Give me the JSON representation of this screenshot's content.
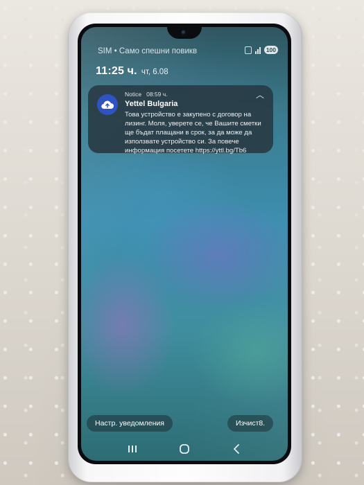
{
  "status_bar": {
    "carrier_text": "SIM • Само спешни повикв",
    "battery_level": "100",
    "icons": [
      "nfc-icon",
      "signal-icon",
      "battery-icon"
    ]
  },
  "lockscreen": {
    "time": "11:25 ч.",
    "date": "чт, 6.08"
  },
  "notification": {
    "app_icon": "cloud-upload-icon",
    "label": "Notice",
    "time": "08:59 ч.",
    "title": "Yettel Bulgaria",
    "body": "Това устройство е закупено с договор на лизинг. Моля, уверете се, че Вашите сметки ще бъдат плащани в срок, за да може да използвате устройство си. За повече информация посетете https://yttl.bg/Tb6",
    "accent_color": "#2f54c2"
  },
  "actions": {
    "notification_settings_label": "Настр. уведомления",
    "clear_label": "Изчист8."
  },
  "navigation": {
    "recents_icon": "recents-icon",
    "home_icon": "home-icon",
    "back_icon": "back-icon"
  }
}
